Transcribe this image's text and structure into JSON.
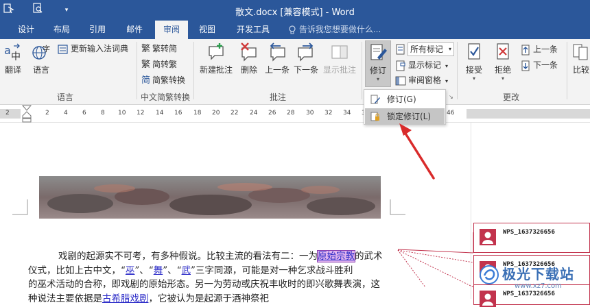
{
  "window": {
    "title": "散文.docx [兼容模式] - Word"
  },
  "tabs": [
    {
      "label": "设计"
    },
    {
      "label": "布局"
    },
    {
      "label": "引用"
    },
    {
      "label": "邮件"
    },
    {
      "label": "审阅"
    },
    {
      "label": "视图"
    },
    {
      "label": "开发工具"
    }
  ],
  "active_tab": "审阅",
  "tell_me": "告诉我您想要做什么...",
  "ribbon": {
    "translate": "翻译",
    "language": "语言",
    "update_ime": "更新输入法词典",
    "group_language": "语言",
    "trad_to_simp": "繁转简",
    "simp_to_trad": "简转繁",
    "simp_trad_convert": "简繁转换",
    "group_chinese": "中文简繁转换",
    "new_comment": "新建批注",
    "delete": "删除",
    "prev": "上一条",
    "next": "下一条",
    "show_comments": "显示批注",
    "group_comments": "批注",
    "track_changes": "修订",
    "markup_dropdown": "所有标记",
    "show_markup": "显示标记",
    "reviewing_pane": "审阅窗格",
    "accept": "接受",
    "reject": "拒绝",
    "prev_change": "上一条",
    "next_change": "下一条",
    "group_changes": "更改",
    "compare": "比较"
  },
  "track_menu": {
    "item_track": "修订(G)",
    "item_lock": "锁定修订(L)"
  },
  "ruler": {
    "marks": [
      "2",
      "2",
      "4",
      "6",
      "8",
      "10",
      "12",
      "14",
      "16",
      "18",
      "20",
      "22",
      "24",
      "26",
      "28",
      "30",
      "32",
      "34",
      "36",
      "38",
      "40",
      "42",
      "44",
      "46"
    ]
  },
  "document": {
    "line1_a": "戏剧的起源实不可考，有多种假说。比较主流的看法有二：一为",
    "line1_hl": "原始宗教",
    "line1_b": "的武术",
    "line2_a": "仪式，比如上古中文，“",
    "line2_w1": "巫",
    "line2_b": "”、“",
    "line2_w2": "舞",
    "line2_c": "”、“",
    "line2_w3": "武",
    "line2_d": "”三字同源，可能是对一种乞求战斗胜利",
    "line3": "的巫术活动的合称，即戏剧的原始形态。另一为劳动或庆祝丰收时的即兴歌舞表演，这",
    "line4_a": "种说法主要依据是",
    "line4_b": "古希腊戏剧",
    "line4_c": "，它被认为是起源于酒神祭祀"
  },
  "comments": [
    {
      "author": "WPS_1637326656"
    },
    {
      "author": "WPS_1637326656"
    },
    {
      "author": "WPS_1637326656"
    }
  ],
  "colors": {
    "brand": "#2b579a",
    "markup": "#c2334d",
    "arrow": "#d92b2b"
  },
  "watermark": {
    "cn": "极光下载站",
    "url": "www.xz7.com"
  }
}
